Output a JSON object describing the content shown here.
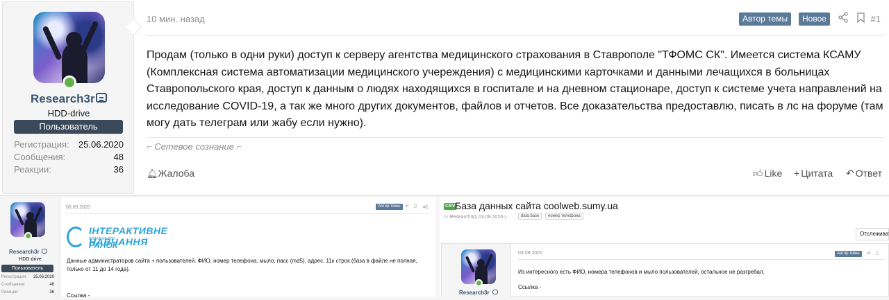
{
  "top_post": {
    "time": "10 мин. назад",
    "badge_author": "Автор темы",
    "badge_new": "Новое",
    "post_number": "#1",
    "text": "Продам (только в одни руки) доступ к серверу агентства медицинского страхования в Ставрополе \"ТФОМС СК\". Имеется система КСАМУ (Комплексная система автоматизации медицинского учереждения) с медицинскими карточками и данными лечащихся в больницах Ставропольского края, доступ к данным о людях находящихся в госпитале и на дневном стационаре, доступ к системе учета направлений на исследование COVID-19, а так же много других документов, файлов и отчетов. Все доказательства предоставлю, писать в лс на форуме (там могу дать телеграм или жабу если нужно).",
    "signature": "Сетевое сознание",
    "report_label": "Жалоба",
    "like_label": "Like",
    "quote_label": "Цитата",
    "reply_label": "Ответ",
    "user": {
      "name": "Research3r",
      "title": "HDD-drive",
      "banner": "Пользователь",
      "stats": [
        {
          "label": "Регистрация:",
          "value": "25.06.2020"
        },
        {
          "label": "Сообщения:",
          "value": "48"
        },
        {
          "label": "Реакции:",
          "value": "36"
        }
      ]
    }
  },
  "bottom_left": {
    "time": "06.09.2020",
    "badge_author": "Автор темы",
    "post_number": "#1",
    "logo_line1": "ІНТЕРАКТИВНЕ НАВЧАННЯ",
    "logo_line2": "ВИДАВНИЦТВО",
    "logo_line3": "РАНОК",
    "text": "Данные администраторов сайта + пользователей. ФИО, номер телефона, мыло, пасс (md5), адрес. 11к строк (база в файле не полная, только от 11 до 14 года).",
    "link_label": "Ссылка -",
    "user": {
      "name": "Research3r",
      "title": "HDD-drive",
      "banner": "Пользователь",
      "stats": [
        {
          "label": "Регистрация:",
          "value": "25.06.2020"
        },
        {
          "label": "Сообщения:",
          "value": "48"
        },
        {
          "label": "Реакции:",
          "value": "36"
        }
      ]
    }
  },
  "bottom_right": {
    "prefix": "CSV",
    "thread_title": "База данных сайта coolweb.sumy.ua",
    "meta_author": "Research3r",
    "meta_date": "03.09.2020",
    "tags": [
      "data base",
      "номер телефона"
    ],
    "follow_label": "Отслеживать",
    "post_time": "03.09.2020",
    "badge_author": "Автор темы",
    "text": "Из интересного есть ФИО, номера телефонов и мыло пользователей, остальное не разгребал.",
    "link_label": "Ссылка -",
    "user_name": "Research3r"
  }
}
